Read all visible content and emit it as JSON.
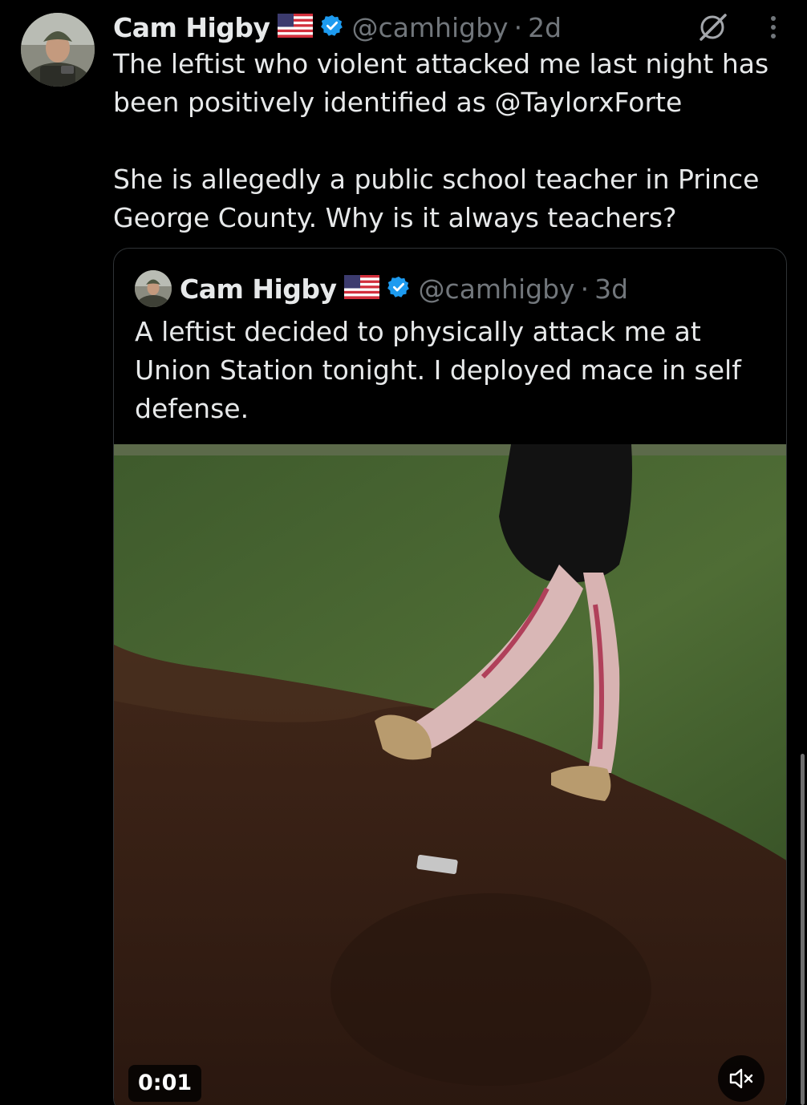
{
  "tweet": {
    "author_name": "Cam Higby",
    "flag_icon": "us-flag-icon",
    "verified_icon": "verified-badge-icon",
    "handle": "@camhigby",
    "separator": "·",
    "time": "2d",
    "text": "The leftist who violent attacked me last night has been positively identified as @TaylorxForte\n\nShe is allegedly a public school teacher in Prince George County. Why is it always teachers?"
  },
  "actions": {
    "grok_icon": "grok-icon",
    "more_icon": "more-options-icon"
  },
  "quoted_tweet": {
    "author_name": "Cam Higby",
    "handle": "@camhigby",
    "separator": "·",
    "time": "3d",
    "text": "A leftist decided to physically attack me at Union Station tonight. I deployed mace in self defense.",
    "video": {
      "timestamp": "0:01",
      "mute_icon": "muted-speaker-icon"
    }
  },
  "colors": {
    "background": "#000000",
    "text_primary": "#e7e9ea",
    "text_secondary": "#71767b",
    "verified_blue": "#1d9bf0",
    "border": "#2f3336"
  }
}
